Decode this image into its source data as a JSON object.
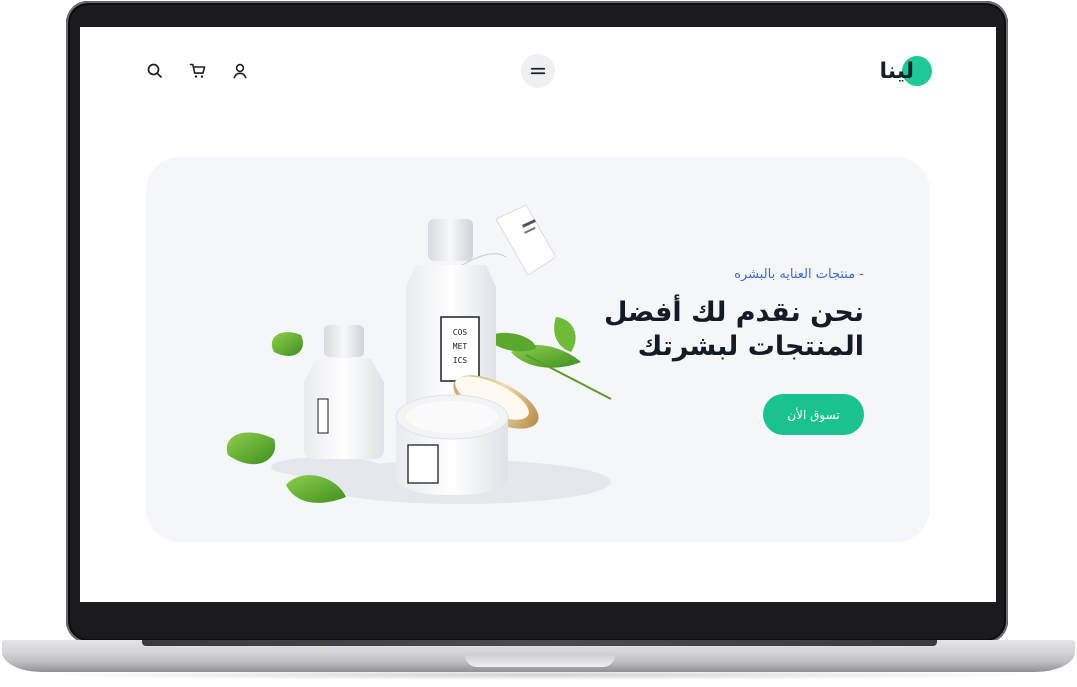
{
  "brand": {
    "name": "لينا",
    "accent": "#1ec997"
  },
  "header": {
    "icons": [
      "search-icon",
      "cart-icon",
      "user-icon",
      "menu-icon"
    ]
  },
  "hero": {
    "eyebrow": "- منتجات العنايه بالبشره",
    "headline_line1": "نحن نقدم لك أفضل",
    "headline_line2": "المنتجات لبشرتك",
    "cta_label": "تسوق الأن",
    "cta_color": "#19c28e",
    "eyebrow_color": "#3b6fd8"
  },
  "product": {
    "bottle_label": "COSMETICS",
    "label_lines": [
      "COS",
      "MET",
      "ICS"
    ]
  }
}
